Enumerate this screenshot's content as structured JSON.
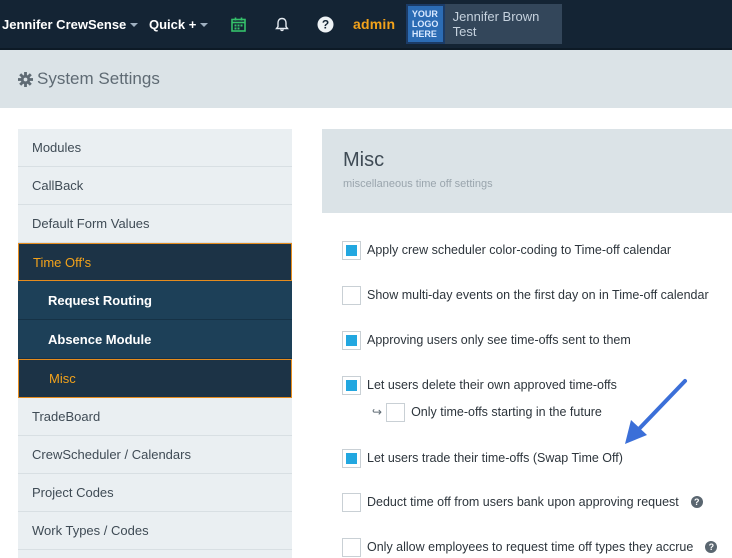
{
  "topbar": {
    "app_name": "Jennifer CrewSense",
    "quick_label": "Quick +",
    "admin_label": "admin",
    "logo_text": "YOUR LOGO HERE",
    "user_name": "Jennifer Brown Test"
  },
  "page": {
    "title": "System Settings"
  },
  "sidebar": {
    "items": [
      {
        "label": "Modules"
      },
      {
        "label": "CallBack"
      },
      {
        "label": "Default Form Values"
      },
      {
        "label": "Time Off's"
      },
      {
        "label": "Request Routing"
      },
      {
        "label": "Absence Module"
      },
      {
        "label": "Misc"
      },
      {
        "label": "TradeBoard"
      },
      {
        "label": "CrewScheduler / Calendars"
      },
      {
        "label": "Project Codes"
      },
      {
        "label": "Work Types / Codes"
      }
    ]
  },
  "content": {
    "title": "Misc",
    "subtitle": "miscellaneous time off settings",
    "options": [
      {
        "label": "Apply crew scheduler color-coding to Time-off calendar",
        "checked": true
      },
      {
        "label": "Show multi-day events on the first day on in Time-off calendar",
        "checked": false
      },
      {
        "label": "Approving users only see time-offs sent to them",
        "checked": true
      },
      {
        "label": "Let users delete their own approved time-offs",
        "checked": true
      },
      {
        "label": "Only time-offs starting in the future",
        "checked": false
      },
      {
        "label": "Let users trade their time-offs (Swap Time Off)",
        "checked": true
      },
      {
        "label": "Deduct time off from users bank upon approving request",
        "checked": false
      },
      {
        "label": "Only allow employees to request time off types they accrue",
        "checked": false
      }
    ]
  },
  "colors": {
    "topbar": "#142434",
    "accent": "#f2a21b",
    "checkbox": "#22a7e0",
    "annotation_arrow": "#3b6fd8"
  }
}
